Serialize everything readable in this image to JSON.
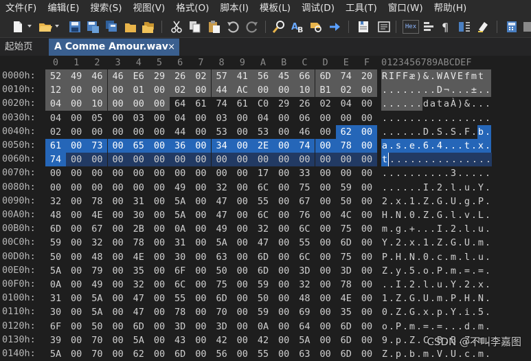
{
  "menu": [
    "文件(F)",
    "编辑(E)",
    "搜索(S)",
    "视图(V)",
    "格式(O)",
    "脚本(I)",
    "模板(L)",
    "调试(D)",
    "工具(T)",
    "窗口(W)",
    "帮助(H)"
  ],
  "toolbar": {
    "icons": [
      "new-file-icon",
      "open-folder-icon",
      "save-icon",
      "save-as-icon",
      "save-all-icon",
      "open-folder-2-icon",
      "open-multiple-icon",
      "cut-icon",
      "copy-icon",
      "paste-icon",
      "undo-icon",
      "redo-icon",
      "find-icon",
      "replace-icon",
      "find-in-files-icon",
      "goto-icon",
      "bookmark-icon",
      "template-icon",
      "hex-mode-icon",
      "insert-mode-icon",
      "paragraph-icon",
      "columns-icon",
      "highlight-icon",
      "calculator-icon",
      "grid-icon"
    ],
    "hex_label": "Hex"
  },
  "tabs": {
    "home": "起始页",
    "file": "A Comme Amour.wav",
    "close_glyph": "×"
  },
  "hex": {
    "col_headers": [
      "0",
      "1",
      "2",
      "3",
      "4",
      "5",
      "6",
      "7",
      "8",
      "9",
      "A",
      "B",
      "C",
      "D",
      "E",
      "F"
    ],
    "ascii_header": "0123456789ABCDEF",
    "rows": [
      {
        "addr": "0000h:",
        "bytes": [
          "52",
          "49",
          "46",
          "46",
          "E6",
          "29",
          "26",
          "02",
          "57",
          "41",
          "56",
          "45",
          "66",
          "6D",
          "74",
          "20"
        ],
        "ascii": "RIFFæ)&.WAVEfmt "
      },
      {
        "addr": "0010h:",
        "bytes": [
          "12",
          "00",
          "00",
          "00",
          "01",
          "00",
          "02",
          "00",
          "44",
          "AC",
          "00",
          "00",
          "10",
          "B1",
          "02",
          "00"
        ],
        "ascii": "........D¬...±.."
      },
      {
        "addr": "0020h:",
        "bytes": [
          "04",
          "00",
          "10",
          "00",
          "00",
          "00",
          "64",
          "61",
          "74",
          "61",
          "C0",
          "29",
          "26",
          "02",
          "04",
          "00"
        ],
        "ascii": "......dataÀ)&..."
      },
      {
        "addr": "0030h:",
        "bytes": [
          "04",
          "00",
          "05",
          "00",
          "03",
          "00",
          "04",
          "00",
          "03",
          "00",
          "04",
          "00",
          "06",
          "00",
          "00",
          "00"
        ],
        "ascii": "................"
      },
      {
        "addr": "0040h:",
        "bytes": [
          "02",
          "00",
          "00",
          "00",
          "00",
          "00",
          "44",
          "00",
          "53",
          "00",
          "53",
          "00",
          "46",
          "00",
          "62",
          "00"
        ],
        "ascii": "......D.S.S.F.b."
      },
      {
        "addr": "0050h:",
        "bytes": [
          "61",
          "00",
          "73",
          "00",
          "65",
          "00",
          "36",
          "00",
          "34",
          "00",
          "2E",
          "00",
          "74",
          "00",
          "78",
          "00"
        ],
        "ascii": "a.s.e.6.4...t.x."
      },
      {
        "addr": "0060h:",
        "bytes": [
          "74",
          "00",
          "00",
          "00",
          "00",
          "00",
          "00",
          "00",
          "00",
          "00",
          "00",
          "00",
          "00",
          "00",
          "00",
          "00"
        ],
        "ascii": "t..............."
      },
      {
        "addr": "0070h:",
        "bytes": [
          "00",
          "00",
          "00",
          "00",
          "00",
          "00",
          "00",
          "00",
          "00",
          "00",
          "17",
          "00",
          "33",
          "00",
          "00",
          "00"
        ],
        "ascii": "..........3....."
      },
      {
        "addr": "0080h:",
        "bytes": [
          "00",
          "00",
          "00",
          "00",
          "00",
          "00",
          "49",
          "00",
          "32",
          "00",
          "6C",
          "00",
          "75",
          "00",
          "59",
          "00"
        ],
        "ascii": "......I.2.l.u.Y."
      },
      {
        "addr": "0090h:",
        "bytes": [
          "32",
          "00",
          "78",
          "00",
          "31",
          "00",
          "5A",
          "00",
          "47",
          "00",
          "55",
          "00",
          "67",
          "00",
          "50",
          "00"
        ],
        "ascii": "2.x.1.Z.G.U.g.P."
      },
      {
        "addr": "00A0h:",
        "bytes": [
          "48",
          "00",
          "4E",
          "00",
          "30",
          "00",
          "5A",
          "00",
          "47",
          "00",
          "6C",
          "00",
          "76",
          "00",
          "4C",
          "00"
        ],
        "ascii": "H.N.0.Z.G.l.v.L."
      },
      {
        "addr": "00B0h:",
        "bytes": [
          "6D",
          "00",
          "67",
          "00",
          "2B",
          "00",
          "0A",
          "00",
          "49",
          "00",
          "32",
          "00",
          "6C",
          "00",
          "75",
          "00"
        ],
        "ascii": "m.g.+...I.2.l.u."
      },
      {
        "addr": "00C0h:",
        "bytes": [
          "59",
          "00",
          "32",
          "00",
          "78",
          "00",
          "31",
          "00",
          "5A",
          "00",
          "47",
          "00",
          "55",
          "00",
          "6D",
          "00"
        ],
        "ascii": "Y.2.x.1.Z.G.U.m."
      },
      {
        "addr": "00D0h:",
        "bytes": [
          "50",
          "00",
          "48",
          "00",
          "4E",
          "00",
          "30",
          "00",
          "63",
          "00",
          "6D",
          "00",
          "6C",
          "00",
          "75",
          "00"
        ],
        "ascii": "P.H.N.0.c.m.l.u."
      },
      {
        "addr": "00E0h:",
        "bytes": [
          "5A",
          "00",
          "79",
          "00",
          "35",
          "00",
          "6F",
          "00",
          "50",
          "00",
          "6D",
          "00",
          "3D",
          "00",
          "3D",
          "00"
        ],
        "ascii": "Z.y.5.o.P.m.=.=."
      },
      {
        "addr": "00F0h:",
        "bytes": [
          "0A",
          "00",
          "49",
          "00",
          "32",
          "00",
          "6C",
          "00",
          "75",
          "00",
          "59",
          "00",
          "32",
          "00",
          "78",
          "00"
        ],
        "ascii": "..I.2.l.u.Y.2.x."
      },
      {
        "addr": "0100h:",
        "bytes": [
          "31",
          "00",
          "5A",
          "00",
          "47",
          "00",
          "55",
          "00",
          "6D",
          "00",
          "50",
          "00",
          "48",
          "00",
          "4E",
          "00"
        ],
        "ascii": "1.Z.G.U.m.P.H.N."
      },
      {
        "addr": "0110h:",
        "bytes": [
          "30",
          "00",
          "5A",
          "00",
          "47",
          "00",
          "78",
          "00",
          "70",
          "00",
          "59",
          "00",
          "69",
          "00",
          "35",
          "00"
        ],
        "ascii": "0.Z.G.x.p.Y.i.5."
      },
      {
        "addr": "0120h:",
        "bytes": [
          "6F",
          "00",
          "50",
          "00",
          "6D",
          "00",
          "3D",
          "00",
          "3D",
          "00",
          "0A",
          "00",
          "64",
          "00",
          "6D",
          "00"
        ],
        "ascii": "o.P.m.=.=...d.m."
      },
      {
        "addr": "0130h:",
        "bytes": [
          "39",
          "00",
          "70",
          "00",
          "5A",
          "00",
          "43",
          "00",
          "42",
          "00",
          "42",
          "00",
          "5A",
          "00",
          "6D",
          "00"
        ],
        "ascii": "9.p.Z.C.B.B.Z.m."
      },
      {
        "addr": "0140h:",
        "bytes": [
          "5A",
          "00",
          "70",
          "00",
          "62",
          "00",
          "6D",
          "00",
          "56",
          "00",
          "55",
          "00",
          "63",
          "00",
          "6D",
          "00"
        ],
        "ascii": "Z.p.b.m.V.U.c.m."
      }
    ]
  },
  "watermark": "CSDN @不叫李嘉图"
}
